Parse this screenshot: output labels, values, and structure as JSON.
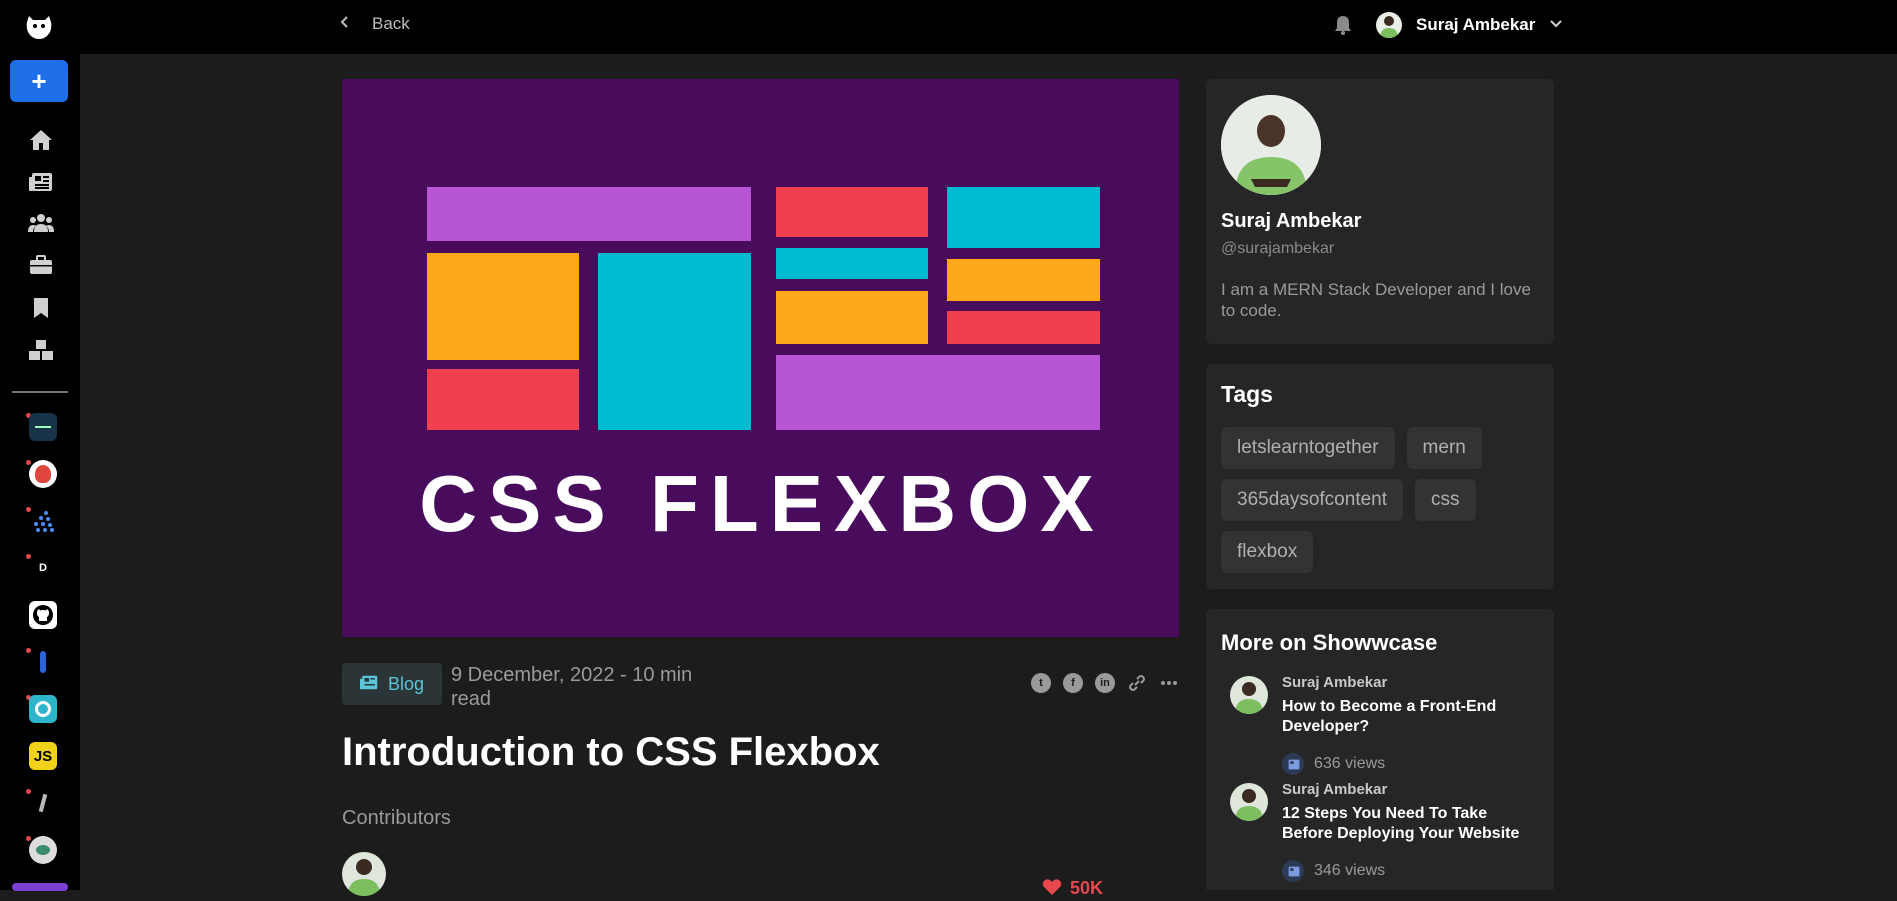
{
  "app": {
    "accent": "#1f6feb"
  },
  "rail": {
    "create_label": "+",
    "nav_icons": [
      "home-icon",
      "newspaper-icon",
      "users-icon",
      "briefcase-icon",
      "bookmark-icon",
      "boxes-icon"
    ],
    "workspace_d": "D",
    "workspace_js": "JS"
  },
  "topbar": {
    "back_label": "Back",
    "user_name": "Suraj Ambekar"
  },
  "hero": {
    "headline": "CSS FLEXBOX",
    "background": "#490b5b"
  },
  "article": {
    "badge_label": "Blog",
    "date": "9 December, 2022 - 10 min read",
    "title": "Introduction to CSS Flexbox",
    "contributors_label": "Contributors",
    "likes": "50K"
  },
  "profile": {
    "name": "Suraj Ambekar",
    "handle": "@surajambekar",
    "bio": "I am a MERN Stack Developer and I love to code."
  },
  "tags": {
    "heading": "Tags",
    "items": [
      "letslearntogether",
      "mern",
      "365daysofcontent",
      "css",
      "flexbox"
    ]
  },
  "more": {
    "heading": "More on Showwcase",
    "posts": [
      {
        "author": "Suraj Ambekar",
        "title": "How to Become a Front-End Developer?",
        "views": "636 views"
      },
      {
        "author": "Suraj Ambekar",
        "title": "12 Steps You Need To Take Before Deploying Your Website",
        "views": "346 views"
      }
    ]
  }
}
